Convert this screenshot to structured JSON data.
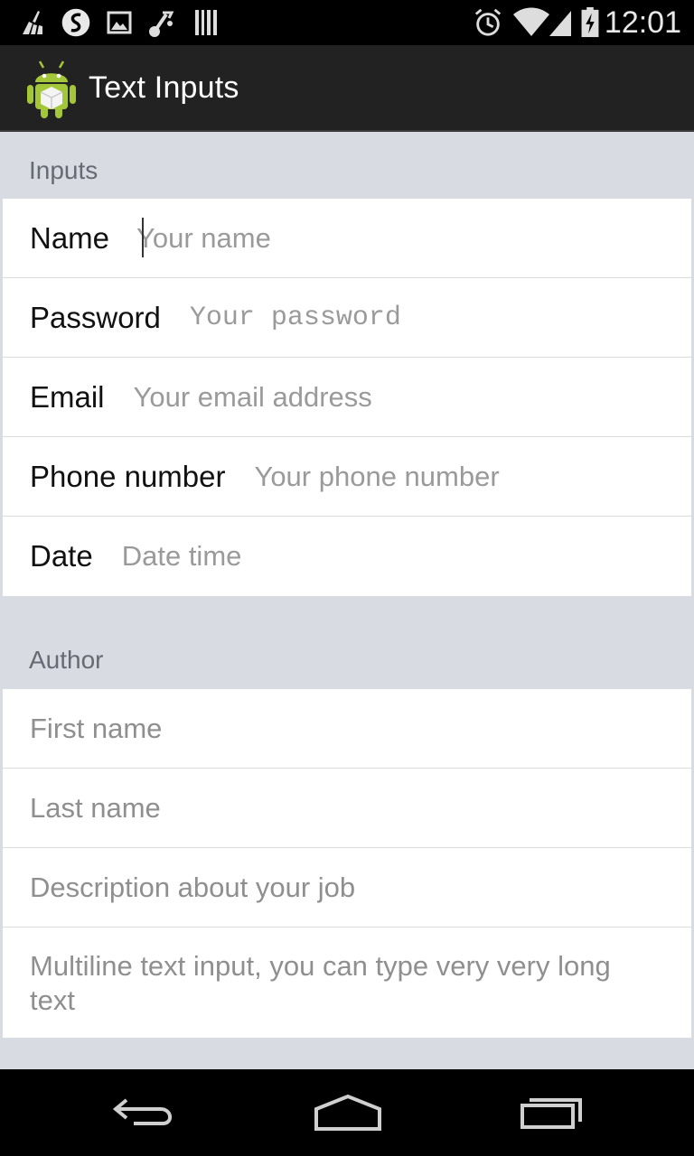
{
  "status_bar": {
    "time": "12:01",
    "left_icons": [
      "cleaner-icon",
      "swiftkey-icon",
      "image-icon",
      "usb-debug-icon",
      "barcode-icon"
    ],
    "right_icons": [
      "alarm-icon",
      "wifi-icon",
      "signal-icon",
      "battery-charging-icon"
    ]
  },
  "action_bar": {
    "title": "Text Inputs",
    "icon": "android-robot-icon"
  },
  "inputs_section": {
    "header": "Inputs",
    "rows": [
      {
        "label": "Name",
        "placeholder": "Your name"
      },
      {
        "label": "Password",
        "placeholder": "Your password"
      },
      {
        "label": "Email",
        "placeholder": "Your email address"
      },
      {
        "label": "Phone number",
        "placeholder": "Your phone number"
      },
      {
        "label": "Date",
        "placeholder": "Date time"
      }
    ]
  },
  "author_section": {
    "header": "Author",
    "first_name_placeholder": "First name",
    "last_name_placeholder": "Last name",
    "description_placeholder": "Description about your job",
    "multiline_placeholder": "Multiline text input, you can type very very long text"
  },
  "nav_bar": {
    "icons": [
      "back-icon",
      "home-icon",
      "recents-icon"
    ]
  },
  "colors": {
    "status_bar_bg": "#000000",
    "action_bar_bg": "#222222",
    "content_bg": "#d8dbe2",
    "card_bg": "#ffffff",
    "placeholder": "#9a9a9a",
    "android_green": "#a4c639"
  }
}
